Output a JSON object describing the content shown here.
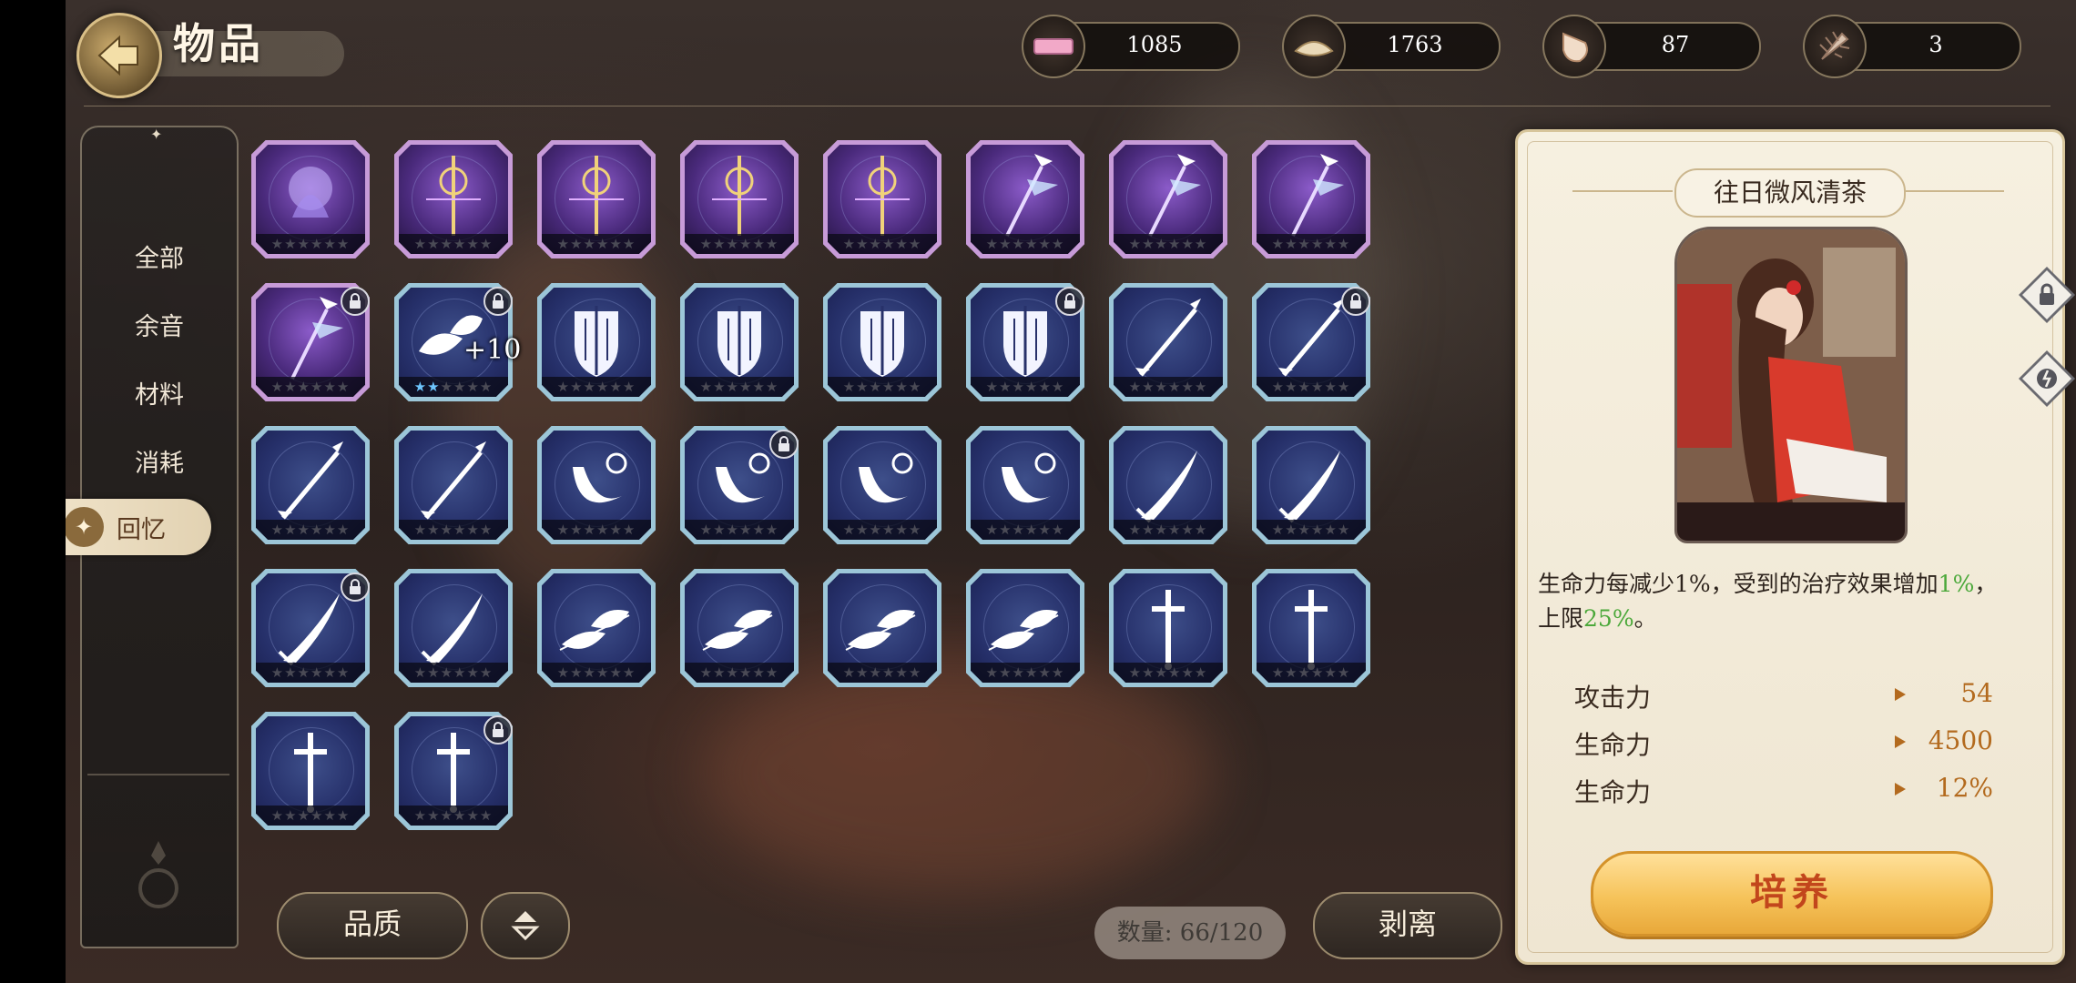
{
  "header": {
    "title": "物品"
  },
  "currencies": [
    {
      "icon": "ticket-icon",
      "value": "1085"
    },
    {
      "icon": "clam-shell-icon",
      "value": "1763"
    },
    {
      "icon": "conch-shell-icon",
      "value": "87"
    },
    {
      "icon": "spiky-shell-icon",
      "value": "3"
    }
  ],
  "sidebar": {
    "items": [
      {
        "label": "全部"
      },
      {
        "label": "余音"
      },
      {
        "label": "材料"
      },
      {
        "label": "消耗"
      },
      {
        "label": "回忆"
      }
    ],
    "active_index": 4
  },
  "items": [
    {
      "type": "purple-spirit",
      "rarity": "purple",
      "stars_lit": 0,
      "locked": false
    },
    {
      "type": "purple-staff",
      "rarity": "purple",
      "stars_lit": 0,
      "locked": false
    },
    {
      "type": "purple-staff",
      "rarity": "purple",
      "stars_lit": 0,
      "locked": false
    },
    {
      "type": "purple-staff",
      "rarity": "purple",
      "stars_lit": 0,
      "locked": false
    },
    {
      "type": "purple-staff",
      "rarity": "purple",
      "stars_lit": 0,
      "locked": false
    },
    {
      "type": "purple-wand",
      "rarity": "purple",
      "stars_lit": 0,
      "locked": false
    },
    {
      "type": "purple-wand",
      "rarity": "purple",
      "stars_lit": 0,
      "locked": false
    },
    {
      "type": "purple-wand",
      "rarity": "purple",
      "stars_lit": 0,
      "locked": false
    },
    {
      "type": "purple-wand",
      "rarity": "purple",
      "stars_lit": 0,
      "locked": true
    },
    {
      "type": "leaf",
      "rarity": "blue",
      "stars_lit": 2,
      "locked": true,
      "level": "+10"
    },
    {
      "type": "shield",
      "rarity": "blue",
      "stars_lit": 0,
      "locked": false
    },
    {
      "type": "shield",
      "rarity": "blue",
      "stars_lit": 0,
      "locked": false
    },
    {
      "type": "shield",
      "rarity": "blue",
      "stars_lit": 0,
      "locked": false
    },
    {
      "type": "shield",
      "rarity": "blue",
      "stars_lit": 0,
      "locked": true
    },
    {
      "type": "spear",
      "rarity": "blue",
      "stars_lit": 0,
      "locked": false
    },
    {
      "type": "spear",
      "rarity": "blue",
      "stars_lit": 0,
      "locked": true
    },
    {
      "type": "spear",
      "rarity": "blue",
      "stars_lit": 0,
      "locked": false
    },
    {
      "type": "spear",
      "rarity": "blue",
      "stars_lit": 0,
      "locked": false
    },
    {
      "type": "horn",
      "rarity": "blue",
      "stars_lit": 0,
      "locked": false
    },
    {
      "type": "horn",
      "rarity": "blue",
      "stars_lit": 0,
      "locked": true
    },
    {
      "type": "horn",
      "rarity": "blue",
      "stars_lit": 0,
      "locked": false
    },
    {
      "type": "horn",
      "rarity": "blue",
      "stars_lit": 0,
      "locked": false
    },
    {
      "type": "blade",
      "rarity": "blue",
      "stars_lit": 0,
      "locked": false
    },
    {
      "type": "blade",
      "rarity": "blue",
      "stars_lit": 0,
      "locked": false
    },
    {
      "type": "blade",
      "rarity": "blue",
      "stars_lit": 0,
      "locked": true
    },
    {
      "type": "blade",
      "rarity": "blue",
      "stars_lit": 0,
      "locked": false
    },
    {
      "type": "twig",
      "rarity": "blue",
      "stars_lit": 0,
      "locked": false
    },
    {
      "type": "twig",
      "rarity": "blue",
      "stars_lit": 0,
      "locked": false
    },
    {
      "type": "twig",
      "rarity": "blue",
      "stars_lit": 0,
      "locked": false
    },
    {
      "type": "twig",
      "rarity": "blue",
      "stars_lit": 0,
      "locked": false
    },
    {
      "type": "sword",
      "rarity": "blue",
      "stars_lit": 0,
      "locked": false
    },
    {
      "type": "sword",
      "rarity": "blue",
      "stars_lit": 0,
      "locked": false
    },
    {
      "type": "sword",
      "rarity": "blue",
      "stars_lit": 0,
      "locked": false
    },
    {
      "type": "sword",
      "rarity": "blue",
      "stars_lit": 0,
      "locked": true
    }
  ],
  "controls": {
    "quality_label": "品质",
    "count_text": "数量: 66/120",
    "strip_label": "剥离"
  },
  "detail": {
    "title": "往日微风清茶",
    "skill_line1_a": "生命力每减少1%，受到的治疗效果增加",
    "skill_line1_hl": "1%",
    "skill_line1_b": "，",
    "skill_line2_a": "上限",
    "skill_line2_hl": "25%",
    "skill_line2_b": "。",
    "stats": [
      {
        "label": "攻击力",
        "value": "54"
      },
      {
        "label": "生命力",
        "value": "4500"
      },
      {
        "label": "生命力",
        "value": "12%"
      }
    ],
    "cultivate_label": "培养"
  },
  "colors": {
    "accent_gold": "#f6c35a",
    "highlight_green": "#4ba83a",
    "stat_value": "#b36a1e"
  }
}
